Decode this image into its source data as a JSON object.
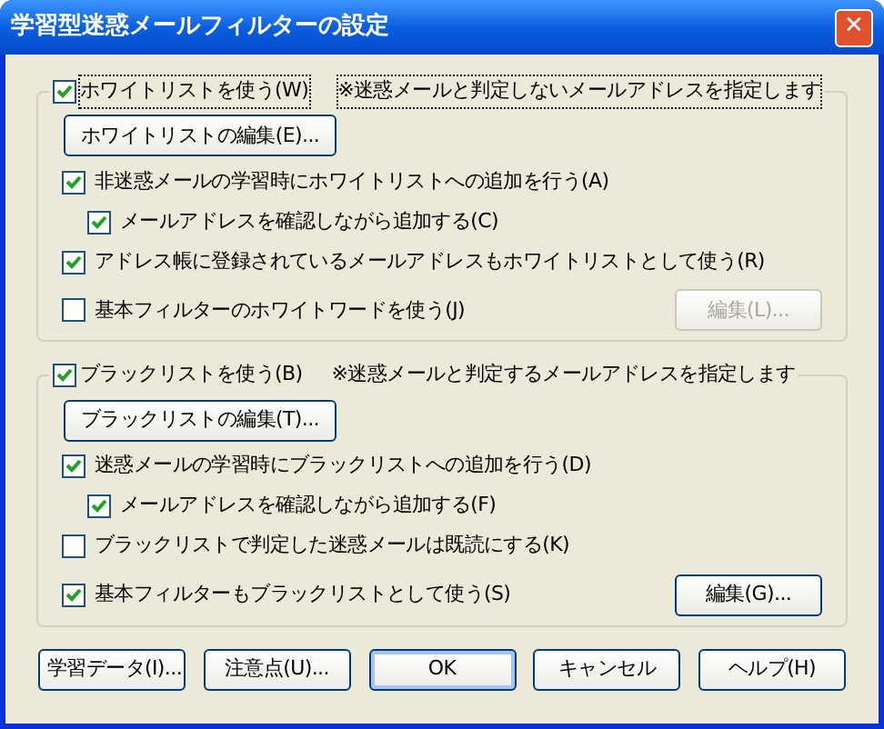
{
  "window": {
    "title": "学習型迷惑メールフィルターの設定",
    "close": "✕"
  },
  "groups": [
    {
      "header": {
        "label": "ホワイトリストを使う(W)",
        "checked": true,
        "focused": true
      },
      "note": "※迷惑メールと判定しないメールアドレスを指定します",
      "edit_button": {
        "label": "ホワイトリストの編集(E)..."
      },
      "options": [
        {
          "label": "非迷惑メールの学習時にホワイトリストへの追加を行う(A)",
          "checked": true,
          "children": [
            {
              "label": "メールアドレスを確認しながら追加する(C)",
              "checked": true
            }
          ]
        },
        {
          "label": "アドレス帳に登録されているメールアドレスもホワイトリストとして使う(R)",
          "checked": true
        },
        {
          "label": "基本フィルターのホワイトワードを使う(J)",
          "checked": false
        }
      ],
      "side_button": {
        "label": "編集(L)...",
        "disabled": true
      }
    },
    {
      "header": {
        "label": "ブラックリストを使う(B)",
        "checked": true,
        "focused": false
      },
      "note": "※迷惑メールと判定するメールアドレスを指定します",
      "edit_button": {
        "label": "ブラックリストの編集(T)..."
      },
      "options": [
        {
          "label": "迷惑メールの学習時にブラックリストへの追加を行う(D)",
          "checked": true,
          "children": [
            {
              "label": "メールアドレスを確認しながら追加する(F)",
              "checked": true
            }
          ]
        },
        {
          "label": "ブラックリストで判定した迷惑メールは既読にする(K)",
          "checked": false
        },
        {
          "label": "基本フィルターもブラックリストとして使う(S)",
          "checked": true
        }
      ],
      "side_button": {
        "label": "編集(G)...",
        "disabled": false
      }
    }
  ],
  "buttons": [
    {
      "label": "学習データ(I)...",
      "default": false
    },
    {
      "label": "注意点(U)...",
      "default": false
    },
    {
      "label": "OK",
      "default": true
    },
    {
      "label": "キャンセル",
      "default": false
    },
    {
      "label": "ヘルプ(H)",
      "default": false
    }
  ]
}
